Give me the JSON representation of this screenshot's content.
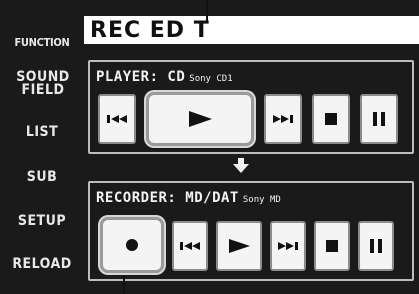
{
  "sidebar": {
    "items": [
      "FUNCTION",
      "SOUND FIELD",
      "LIST",
      "SUB",
      "SETUP",
      "RELOAD"
    ]
  },
  "title": "REC ED T",
  "player": {
    "label": "PLAYER: CD",
    "model": "Sony CD1",
    "buttons": [
      {
        "icon": "skip-back-icon",
        "label": "previous"
      },
      {
        "icon": "play-icon",
        "label": "play",
        "selected": true
      },
      {
        "icon": "skip-forward-icon",
        "label": "next"
      },
      {
        "icon": "stop-icon",
        "label": "stop"
      },
      {
        "icon": "pause-icon",
        "label": "pause"
      }
    ]
  },
  "recorder": {
    "label": "RECORDER: MD/DAT",
    "model": "Sony MD",
    "buttons": [
      {
        "icon": "record-icon",
        "label": "record",
        "selected": true
      },
      {
        "icon": "skip-back-icon",
        "label": "previous"
      },
      {
        "icon": "play-icon",
        "label": "play"
      },
      {
        "icon": "skip-forward-icon",
        "label": "next"
      },
      {
        "icon": "stop-icon",
        "label": "stop"
      },
      {
        "icon": "pause-icon",
        "label": "pause"
      }
    ]
  },
  "colors": {
    "screen_bg": "#1a1a1a",
    "button_bg": "#f4f4f4",
    "icon": "#111111",
    "panel_border": "#bdbdbd"
  }
}
